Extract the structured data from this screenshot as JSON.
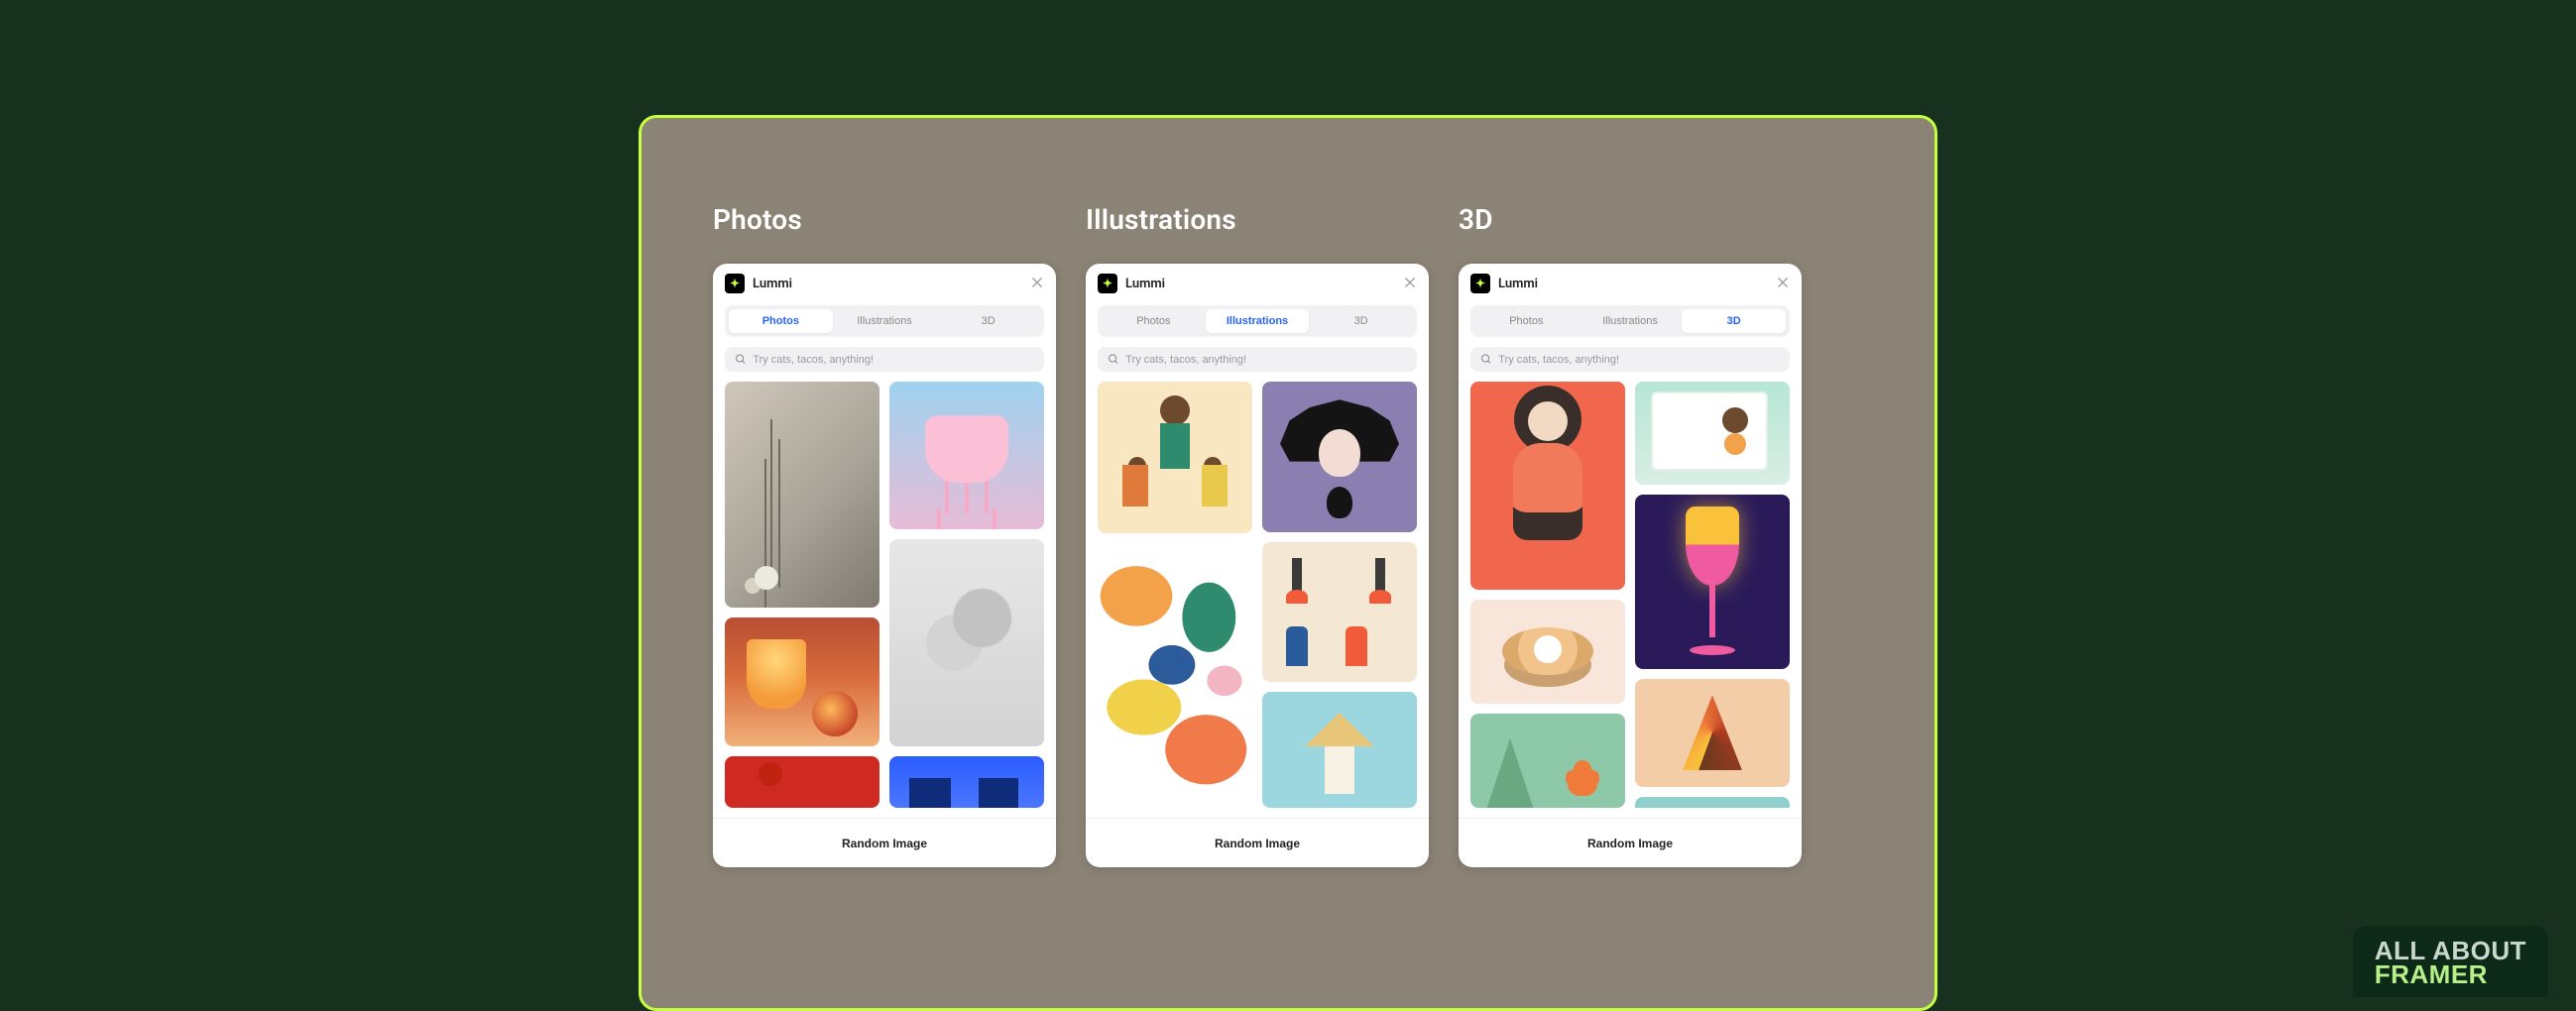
{
  "panels": [
    {
      "title": "Photos",
      "active_tab": 0
    },
    {
      "title": "Illustrations",
      "active_tab": 1
    },
    {
      "title": "3D",
      "active_tab": 2
    }
  ],
  "brand": "Lummi",
  "tabs": [
    "Photos",
    "Illustrations",
    "3D"
  ],
  "search_placeholder": "Try cats, tacos, anything!",
  "footer_button": "Random Image",
  "watermark": {
    "line1": "ALL ABOUT",
    "line2": "FRAMER"
  }
}
